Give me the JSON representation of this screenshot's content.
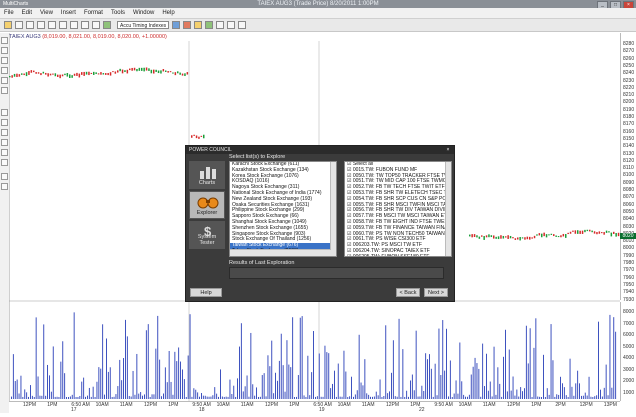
{
  "window": {
    "app_name": "MultiCharts",
    "title": "TAIEX AUG3 (Trade Price) 8/20/2011 1:00PM",
    "controls": [
      "_",
      "□",
      "×"
    ]
  },
  "menu": [
    "File",
    "Edit",
    "View",
    "Insert",
    "Format",
    "Tools",
    "Window",
    "Help"
  ],
  "toolbar": {
    "symbol_combo": "Accu Timing Indexes",
    "icons": [
      "new-icon",
      "open-icon",
      "save-icon",
      "print-icon",
      "zoom-icon",
      "cut-icon",
      "copy-icon",
      "paste-icon",
      "cursor-icon",
      "plus-icon",
      "trend-icon",
      "signal-icon",
      "dollar-icon",
      "portfolio-icon",
      "chart-icon",
      "grid-icon",
      "window-icon"
    ]
  },
  "chart_header": {
    "symbol": "TAIEX AUG3",
    "values": "(8,019.00, 8,021.00, 8,019.00, 8,020.00, +1.00000)"
  },
  "price_axis": {
    "ticks": [
      "8280",
      "8270",
      "8260",
      "8250",
      "8240",
      "8230",
      "8220",
      "8210",
      "8200",
      "8190",
      "8180",
      "8170",
      "8160",
      "8150",
      "8140",
      "8130",
      "8120",
      "8110",
      "8100",
      "8090",
      "8080",
      "8070",
      "8060",
      "8050",
      "8040",
      "8030",
      "8020",
      "8010",
      "8000",
      "7990",
      "7980",
      "7970",
      "7960",
      "7950",
      "7940",
      "7930"
    ],
    "current_price": "8020"
  },
  "volume_axis": {
    "ticks": [
      "8000",
      "7000",
      "6000",
      "5000",
      "4000",
      "3000",
      "2000",
      "1000"
    ]
  },
  "time_axis": {
    "labels": [
      "12PM",
      "1PM",
      "6:50 AM",
      "10AM",
      "11AM",
      "12PM",
      "1PM",
      "9:50 AM",
      "10AM",
      "11AM",
      "12PM",
      "1PM",
      "6:50 AM",
      "10AM",
      "11AM",
      "12PM",
      "1PM",
      "9:50 AM",
      "10AM",
      "11AM",
      "12PM",
      "1PM",
      "2PM",
      "12PM",
      "13PM"
    ],
    "days": [
      "17",
      "18",
      "19",
      "22"
    ]
  },
  "dialog": {
    "title": "POWER COUNCIL",
    "close": "×",
    "left_list_label": "Select list(s) to Explore",
    "nav": [
      {
        "label": "Charts",
        "icon": "bar-chart-icon"
      },
      {
        "label": "Explorer",
        "icon": "binoculars-icon"
      },
      {
        "label": "System Tester",
        "icon": "dollar-icon"
      }
    ],
    "exchanges": [
      "Karachi Stock Exchange (611)",
      "Kazakhstan Stock Exchange (134)",
      "Korea Stock Exchange (1076)",
      "KOSDAQ (1016)",
      "Nagoya Stock Exchange (311)",
      "National Stock Exchange of India (1774)",
      "New Zealand Stock Exchange (193)",
      "Osaka Securities Exchange (1631)",
      "Philippine Stock Exchange (299)",
      "Sapporo Stock Exchange (66)",
      "Shanghai Stock Exchange (1049)",
      "Shenzhen Stock Exchange (1655)",
      "Singapore Stock Exchange (903)",
      "Stock Exchange Of Thailand (1256)",
      "Taiwan Stock Exchange (676)",
      "Tokyo Stock Exchange (2603)"
    ],
    "selected_exchange": "Taiwan Stock Exchange (676)",
    "symbols": [
      "Select all",
      "0015.TW: FUBON FUND MF",
      "0050.TW: TW TOP50 TRACKER FTSE TWSE",
      "0051.TW: TW MID CAP 100 FTSE TWMC ETF",
      "0052.TW: FB TW TECH FTSE TWIT ETF",
      "0053.TW: FB SHR TW ELETECH TSEC TELI ETF",
      "0054.TW: FB SHR SCP CUS CN S&P POLAR ETF",
      "0055.TW: FB SHR MSCI TWFIN MSCI TAIWAN",
      "0056.TW: FB SHR TW DIV TAIWAN DIVIDEND",
      "0057.TW: FB MSCI TW MSCI TAIWAN ETF",
      "0058.TW: FB TW EIGHT IND FTSE TWEI ETF",
      "0059.TW: FB TW FINANCE TAIWAN FINANCE",
      "0060.TW: PS TW NON TECH50 TAIWAN NON",
      "0061.TW: PS WISE CSI300 ETF",
      "006203.TW: PS MSCI TW ETF",
      "006204.TW: SINOPAC TAIEX ETF",
      "006205.TW: FUBON SSE180 ETF"
    ],
    "results_label": "Results of Last Exploration",
    "help_button": "Help",
    "back_button": "< Back",
    "next_button": "Next >"
  },
  "colors": {
    "up_candle": "#1a9e3a",
    "down_candle": "#d62a2a",
    "volume": "#2a3fb8",
    "dialog_bg": "#3b3b3b",
    "selection": "#3a73c7"
  }
}
